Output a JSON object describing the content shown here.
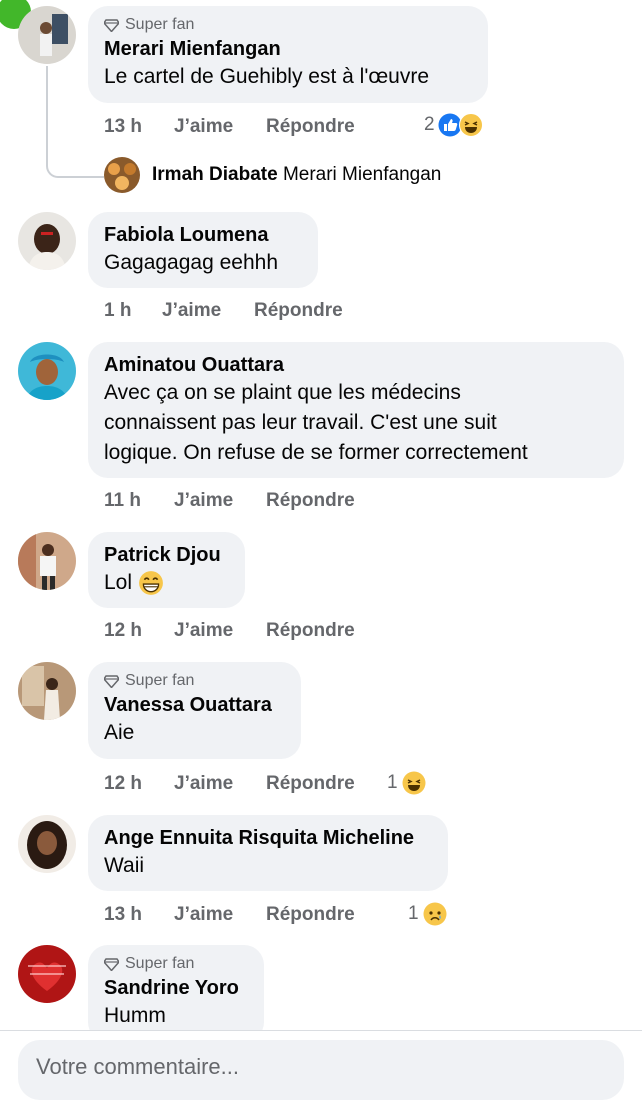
{
  "labels": {
    "like": "J’aime",
    "reply": "Répondre",
    "super_fan": "Super fan"
  },
  "comments": [
    {
      "name": "Merari Mienfangan",
      "badge": "Super fan",
      "text": "Le cartel de Guehibly est à l'œuvre",
      "time": "13 h",
      "reaction_count": "2",
      "reactions": [
        "like",
        "haha"
      ]
    },
    {
      "name": "Fabiola Loumena",
      "text": "Gagagagag eehhh",
      "time": "1 h"
    },
    {
      "name": "Aminatou Ouattara",
      "text_lines": [
        "Avec ça on se plaint que les médecins",
        "connaissent pas leur travail. C'est une suit",
        "logique. On refuse de se former correctement"
      ],
      "time": "11 h"
    },
    {
      "name": "Patrick Djou",
      "text": "Lol",
      "emoji": "grin",
      "time": "12 h"
    },
    {
      "name": "Vanessa Ouattara",
      "badge": "Super fan",
      "text": "Aie",
      "time": "12 h",
      "reaction_count": "1",
      "reactions": [
        "haha"
      ]
    },
    {
      "name": "Ange Ennuita Risquita Micheline",
      "text": "Waii",
      "time": "13 h",
      "reaction_count": "1",
      "reactions": [
        "sad"
      ]
    },
    {
      "name": "Sandrine Yoro",
      "badge": "Super fan",
      "text": "Humm"
    }
  ],
  "reply_preview": {
    "name": "Irmah Diabate",
    "mention": "Merari Mienfangan"
  },
  "composer": {
    "placeholder": "Votre commentaire..."
  },
  "colors": {
    "bubble": "#f0f2f5",
    "secondary_text": "#65676b",
    "like_blue": "#1877f2",
    "emoji_yellow": "#f7c64a"
  }
}
